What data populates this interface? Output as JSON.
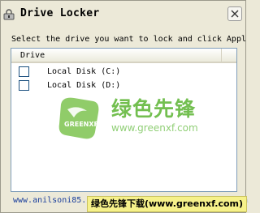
{
  "window": {
    "title": "Drive Locker",
    "instruction": "Select the drive you want to lock and click Appl"
  },
  "list": {
    "column_header": "Drive",
    "rows": [
      {
        "label": "Local Disk (C:)",
        "checked": false
      },
      {
        "label": "Local Disk (D:)",
        "checked": false
      }
    ]
  },
  "footer": {
    "link_text": "www.anilsoni85.blogspot.com/Any Query? Email: anilsoni85@gmail.com"
  },
  "watermark": {
    "logo_text": "GREENXF.COM",
    "chinese_name": "绿色先锋",
    "url": "www.greenxf.com",
    "banner": "绿色先锋下载(www.greenxf.com)"
  },
  "colors": {
    "window_bg": "#ece9d8",
    "list_border": "#7f9db9",
    "watermark_green": "#5bb432",
    "banner_bg": "#f6f18a",
    "link": "#1a3e9c"
  },
  "icons": {
    "app": "lock-drive-icon",
    "close": "close-icon"
  }
}
